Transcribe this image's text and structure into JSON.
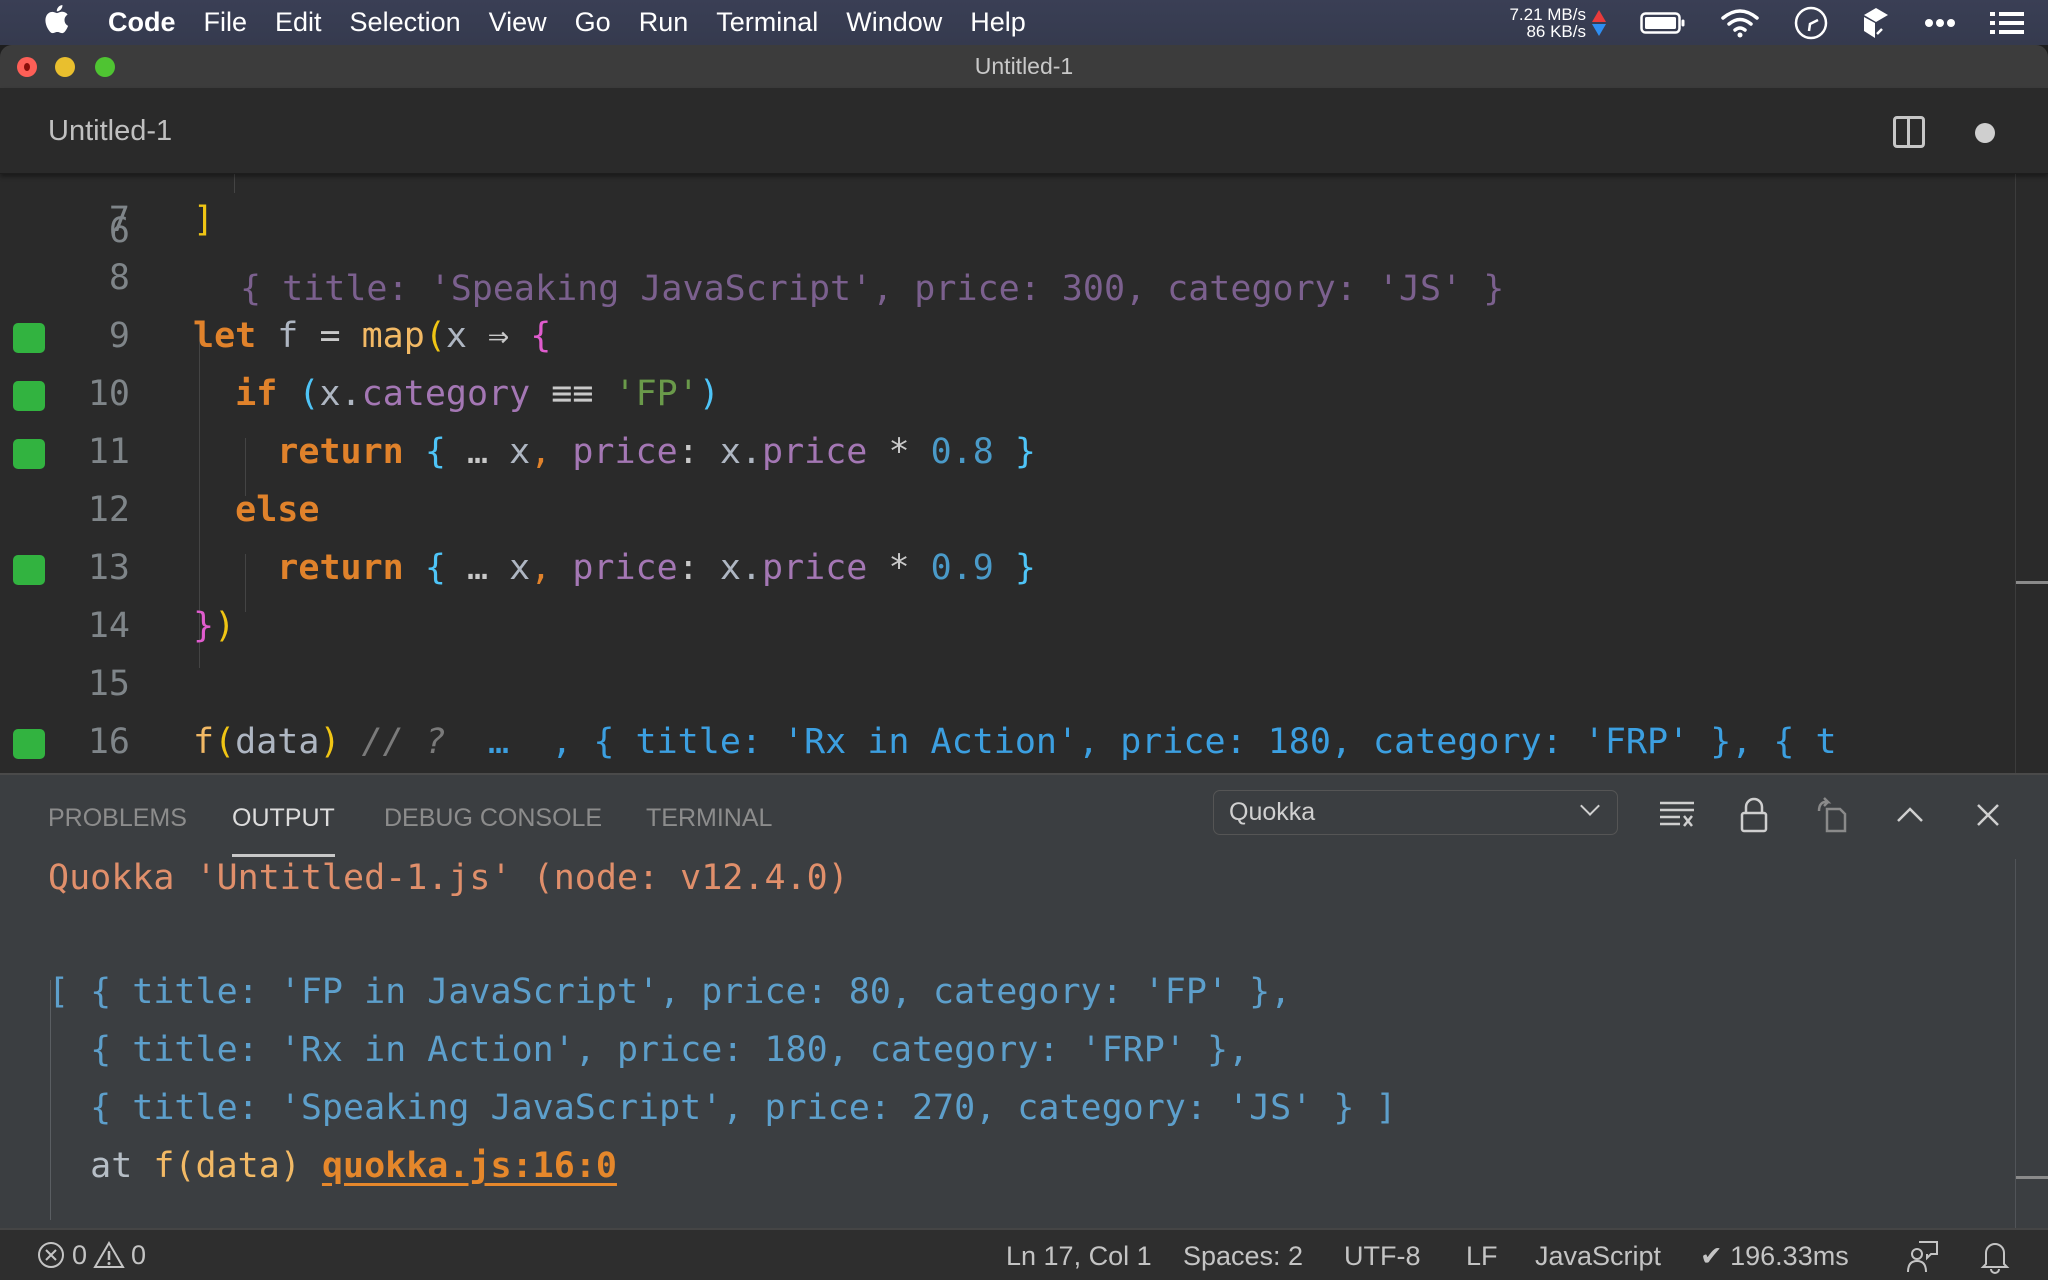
{
  "menubar": {
    "apple_icon": "apple-logo-icon",
    "app_name": "Code",
    "items": [
      "File",
      "Edit",
      "Selection",
      "View",
      "Go",
      "Run",
      "Terminal",
      "Window",
      "Help"
    ],
    "net_up": "7.21 MB/s",
    "net_down": "86 KB/s",
    "tray_icons": [
      "battery-icon",
      "wifi-icon",
      "clock-icon",
      "app-cube-icon",
      "more-icon",
      "control-list-icon"
    ]
  },
  "window": {
    "title": "Untitled-1",
    "tab_label": "Untitled-1",
    "tab_dirty": true
  },
  "editor": {
    "partial_top_line": {
      "number": "6",
      "text": "{ title: 'Speaking JavaScript', price: 300, category: 'JS' }"
    },
    "lines": [
      {
        "number": "7",
        "marker": false,
        "tokens": [
          {
            "t": "]",
            "c": "b1"
          }
        ]
      },
      {
        "number": "8",
        "marker": false,
        "tokens": []
      },
      {
        "number": "9",
        "marker": true,
        "tokens": [
          {
            "t": "let",
            "c": "k"
          },
          {
            "t": " f ",
            "c": "v"
          },
          {
            "t": "=",
            "c": "op"
          },
          {
            "t": " ",
            "c": "v"
          },
          {
            "t": "map",
            "c": "fn"
          },
          {
            "t": "(",
            "c": "b1"
          },
          {
            "t": "x ",
            "c": "v"
          },
          {
            "t": "⇒",
            "c": "op"
          },
          {
            "t": " ",
            "c": "v"
          },
          {
            "t": "{",
            "c": "b2"
          }
        ]
      },
      {
        "number": "10",
        "marker": true,
        "tokens": [
          {
            "t": "  ",
            "c": "v"
          },
          {
            "t": "if",
            "c": "k"
          },
          {
            "t": " ",
            "c": "v"
          },
          {
            "t": "(",
            "c": "b3"
          },
          {
            "t": "x.",
            "c": "v"
          },
          {
            "t": "category",
            "c": "pr"
          },
          {
            "t": " ≡≡ ",
            "c": "op"
          },
          {
            "t": "'FP'",
            "c": "st"
          },
          {
            "t": ")",
            "c": "b3"
          }
        ]
      },
      {
        "number": "11",
        "marker": true,
        "tokens": [
          {
            "t": "    ",
            "c": "v"
          },
          {
            "t": "return",
            "c": "k"
          },
          {
            "t": " ",
            "c": "v"
          },
          {
            "t": "{",
            "c": "b3"
          },
          {
            "t": " … ",
            "c": "op"
          },
          {
            "t": "x",
            "c": "v"
          },
          {
            "t": ",",
            "c": "kw"
          },
          {
            "t": " ",
            "c": "v"
          },
          {
            "t": "price",
            "c": "pr"
          },
          {
            "t": ": ",
            "c": "op"
          },
          {
            "t": "x.",
            "c": "v"
          },
          {
            "t": "price",
            "c": "pr"
          },
          {
            "t": " * ",
            "c": "op"
          },
          {
            "t": "0.8",
            "c": "nu"
          },
          {
            "t": " ",
            "c": "v"
          },
          {
            "t": "}",
            "c": "b3"
          }
        ]
      },
      {
        "number": "12",
        "marker": false,
        "tokens": [
          {
            "t": "  ",
            "c": "v"
          },
          {
            "t": "else",
            "c": "k"
          }
        ]
      },
      {
        "number": "13",
        "marker": true,
        "tokens": [
          {
            "t": "    ",
            "c": "v"
          },
          {
            "t": "return",
            "c": "k"
          },
          {
            "t": " ",
            "c": "v"
          },
          {
            "t": "{",
            "c": "b3"
          },
          {
            "t": " … ",
            "c": "op"
          },
          {
            "t": "x",
            "c": "v"
          },
          {
            "t": ",",
            "c": "kw"
          },
          {
            "t": " ",
            "c": "v"
          },
          {
            "t": "price",
            "c": "pr"
          },
          {
            "t": ": ",
            "c": "op"
          },
          {
            "t": "x.",
            "c": "v"
          },
          {
            "t": "price",
            "c": "pr"
          },
          {
            "t": " * ",
            "c": "op"
          },
          {
            "t": "0.9",
            "c": "nu"
          },
          {
            "t": " ",
            "c": "v"
          },
          {
            "t": "}",
            "c": "b3"
          }
        ]
      },
      {
        "number": "14",
        "marker": false,
        "tokens": [
          {
            "t": "}",
            "c": "b2"
          },
          {
            "t": ")",
            "c": "b1"
          }
        ]
      },
      {
        "number": "15",
        "marker": false,
        "tokens": []
      },
      {
        "number": "16",
        "marker": true,
        "tokens": [
          {
            "t": "f",
            "c": "fn"
          },
          {
            "t": "(",
            "c": "b1"
          },
          {
            "t": "data",
            "c": "v"
          },
          {
            "t": ")",
            "c": "b1"
          },
          {
            "t": " // ?",
            "c": "cm"
          },
          {
            "t": "  …  , { title: 'Rx in Action', price: 180, category: 'FRP' }, { t",
            "c": "qk"
          }
        ]
      }
    ]
  },
  "panel": {
    "tabs": [
      {
        "label": "PROBLEMS",
        "active": false
      },
      {
        "label": "OUTPUT",
        "active": true
      },
      {
        "label": "DEBUG CONSOLE",
        "active": false
      },
      {
        "label": "TERMINAL",
        "active": false
      }
    ],
    "channel_select": "Quokka",
    "actions": [
      "clear-output-icon",
      "lock-scroll-icon",
      "open-in-editor-icon",
      "maximize-panel-icon",
      "close-panel-icon"
    ],
    "output": {
      "header": "Quokka 'Untitled-1.js' (node: v12.4.0)",
      "lines": [
        "[ { title: 'FP in JavaScript', price: 80, category: 'FP' },",
        "  { title: 'Rx in Action', price: 180, category: 'FRP' },",
        "  { title: 'Speaking JavaScript', price: 270, category: 'JS' } ]"
      ],
      "at_prefix": "  at ",
      "at_fn": "f(data)",
      "at_link": "quokka.js:16:0"
    }
  },
  "statusbar": {
    "errors": "0",
    "warnings": "0",
    "position": "Ln 17, Col 1",
    "indent": "Spaces: 2",
    "encoding": "UTF-8",
    "eol": "LF",
    "language": "JavaScript",
    "quokka_time": "✔ 196.33ms"
  },
  "colors": {
    "gutter_marker": "#32b340",
    "keyword": "#e0822b",
    "string": "#6a9a4a",
    "property": "#a477b4",
    "number": "#4a9ac8",
    "quokka_value": "#3c9fe0",
    "output_header": "#e08f6b"
  }
}
